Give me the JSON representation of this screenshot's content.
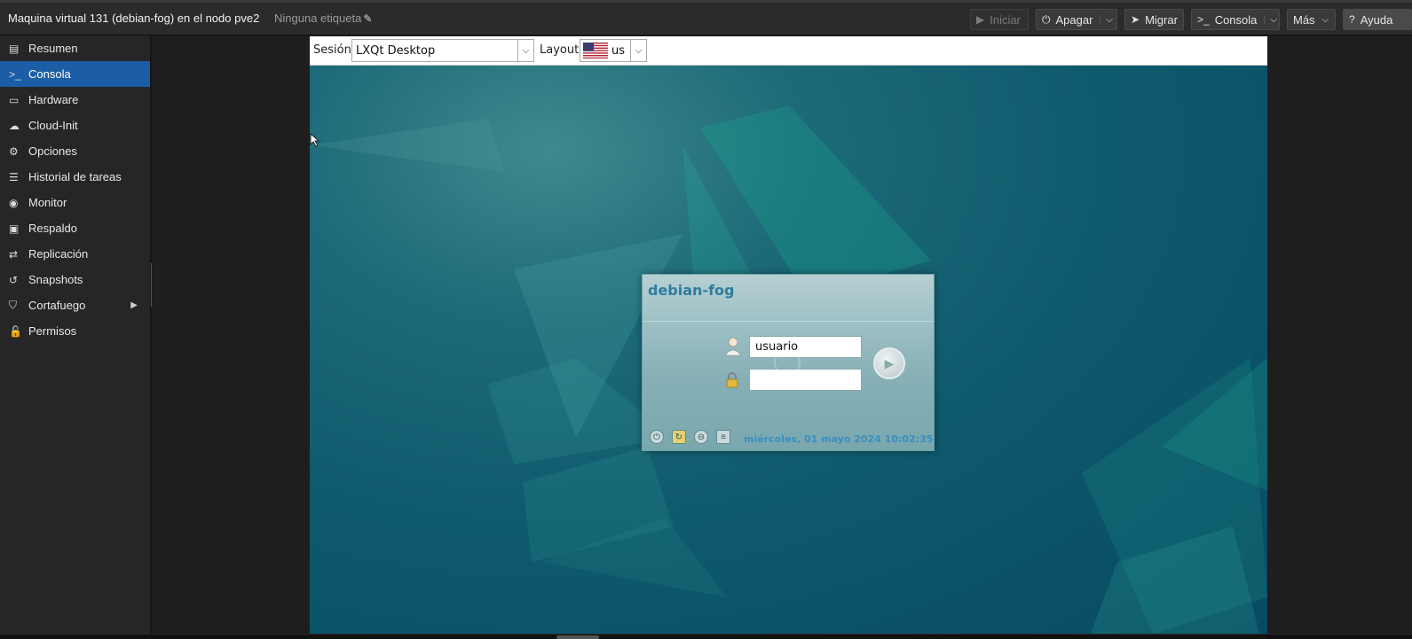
{
  "header": {
    "title": "Maquina virtual 131 (debian-fog) en el nodo pve2",
    "tags_label": "Ninguna etiqueta",
    "buttons": {
      "start": "Iniciar",
      "shutdown": "Apagar",
      "migrate": "Migrar",
      "console": "Consola",
      "more": "Más",
      "help": "Ayuda"
    }
  },
  "sidebar": {
    "items": [
      {
        "label": "Resumen",
        "icon": "book-icon"
      },
      {
        "label": "Consola",
        "icon": "terminal-icon",
        "active": true
      },
      {
        "label": "Hardware",
        "icon": "monitor-icon"
      },
      {
        "label": "Cloud-Init",
        "icon": "cloud-icon"
      },
      {
        "label": "Opciones",
        "icon": "gear-icon"
      },
      {
        "label": "Historial de tareas",
        "icon": "list-icon"
      },
      {
        "label": "Monitor",
        "icon": "eye-icon"
      },
      {
        "label": "Respaldo",
        "icon": "floppy-icon"
      },
      {
        "label": "Replicación",
        "icon": "retweet-icon"
      },
      {
        "label": "Snapshots",
        "icon": "history-icon"
      },
      {
        "label": "Cortafuego",
        "icon": "shield-icon",
        "has_submenu": true
      },
      {
        "label": "Permisos",
        "icon": "unlock-icon"
      }
    ]
  },
  "console": {
    "session_label": "Sesión",
    "session_value": "LXQt Desktop",
    "layout_label": "Layout",
    "layout_value": "us",
    "login": {
      "hostname": "debian-fog",
      "username": "usuario",
      "date": "miércoles, 01 mayo 2024 10:02:35"
    }
  },
  "colors": {
    "accent": "#1b5ea6",
    "desktop_bg": "#0e5a6d",
    "hostname": "#2e7d9e"
  }
}
